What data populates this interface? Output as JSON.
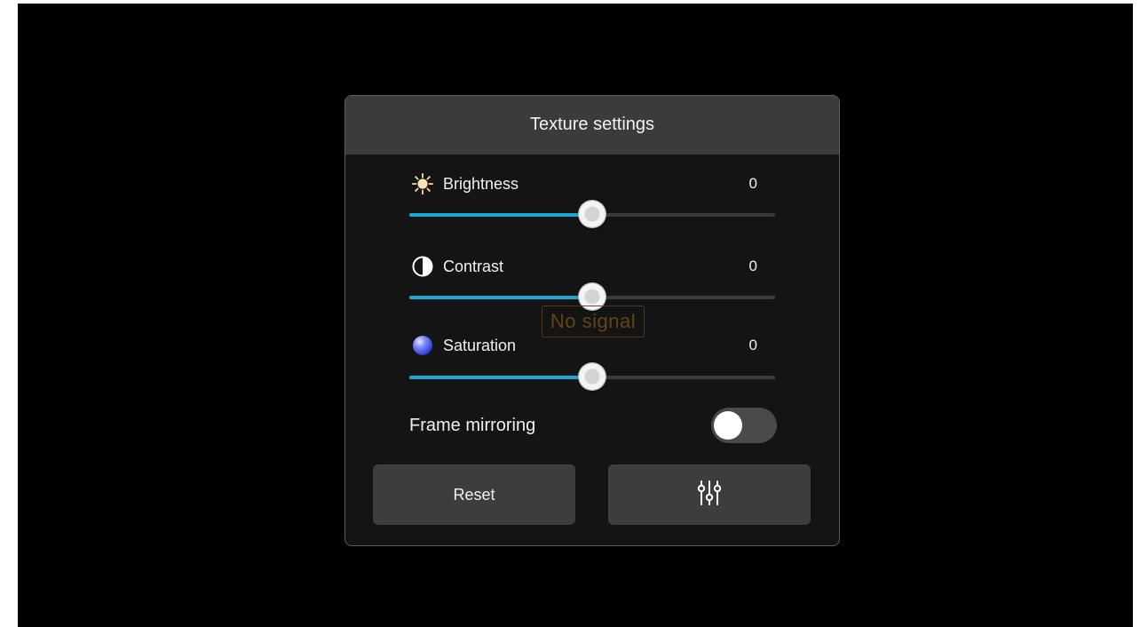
{
  "panel": {
    "title": "Texture settings"
  },
  "overlay": {
    "no_signal": "No signal"
  },
  "settings": {
    "brightness": {
      "label": "Brightness",
      "value": "0",
      "level": 0.5,
      "icon": "sun-icon"
    },
    "contrast": {
      "label": "Contrast",
      "value": "0",
      "level": 0.5,
      "icon": "contrast-icon"
    },
    "saturation": {
      "label": "Saturation",
      "value": "0",
      "level": 0.5,
      "icon": "saturation-icon"
    }
  },
  "mirroring": {
    "label": "Frame mirroring",
    "enabled": false
  },
  "buttons": {
    "reset_label": "Reset",
    "adjust_icon": "sliders-icon"
  },
  "colors": {
    "accent": "#1aa9d6",
    "header_bg": "#3a3b3c",
    "panel_bg": "#141414",
    "button_bg": "#3d3d3e",
    "no_signal_text": "#6a4a18"
  }
}
